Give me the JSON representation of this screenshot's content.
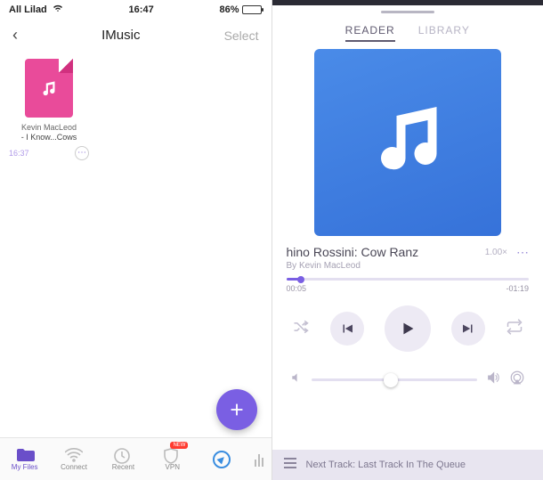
{
  "left": {
    "status": {
      "carrier": "All Lilad",
      "wifi": "wifi-icon",
      "time": "16:47",
      "battery_pct": "86%"
    },
    "nav": {
      "back": "‹",
      "title": "IMusic",
      "select": "Select"
    },
    "file": {
      "line1": "Kevin MacLeod",
      "line2": "- I Know...Cows",
      "time": "16:37",
      "more": "⋯"
    },
    "fab": "+",
    "tabs": [
      {
        "label": "My Files",
        "icon": "folder",
        "active": true
      },
      {
        "label": "Connect",
        "icon": "wifi",
        "active": false
      },
      {
        "label": "Recent",
        "icon": "clock",
        "active": false
      },
      {
        "label": "VPN",
        "icon": "shield",
        "badge": "NEW",
        "active": false
      }
    ]
  },
  "right": {
    "tabs": {
      "reader": "READER",
      "library": "LIBRARY"
    },
    "track": {
      "title": "hino Rossini: Cow Ranz",
      "artist": "By Kevin MacLeod",
      "speed": "1.00×",
      "more": "⋯"
    },
    "progress": {
      "elapsed": "00:05",
      "remaining": "-01:19"
    },
    "queue": {
      "label": "Next Track: Last Track In The Queue"
    }
  }
}
